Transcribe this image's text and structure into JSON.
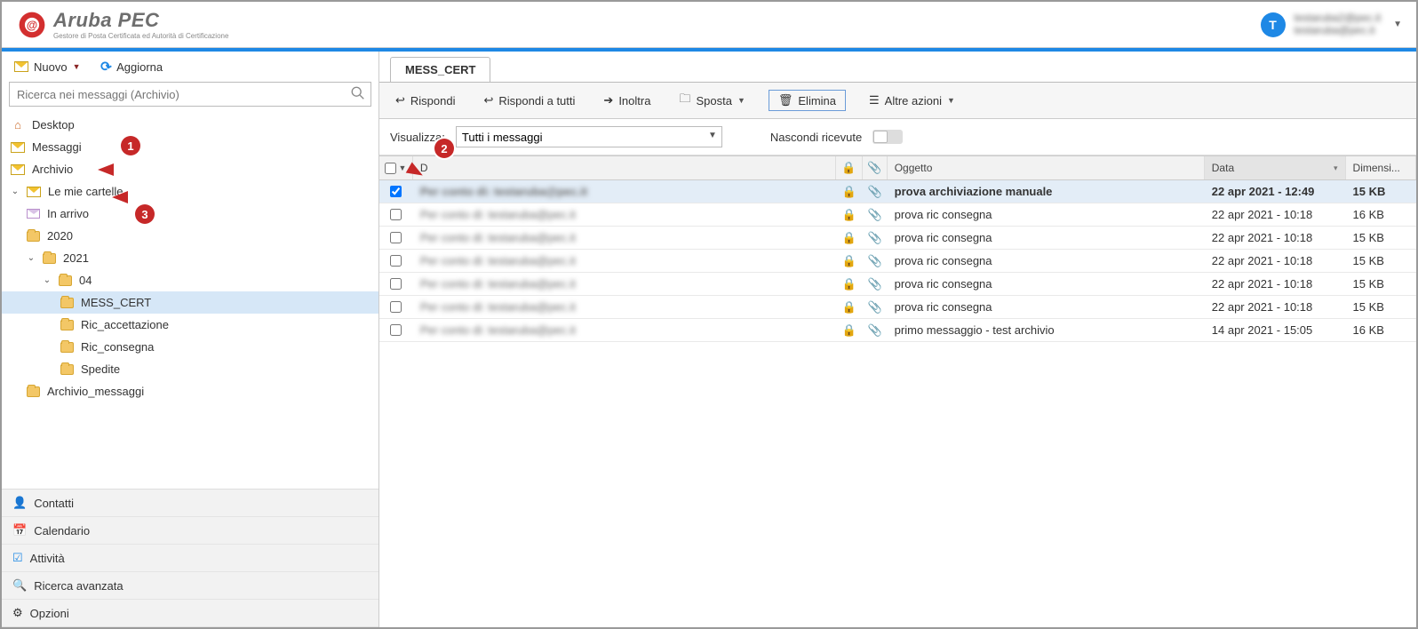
{
  "brand": {
    "name": "Aruba PEC",
    "sub": "Gestore di Posta Certificata ed Autorità di Certificazione"
  },
  "user": {
    "initial": "T",
    "line1": "testaruba2@pec.it",
    "line2": "testaruba@pec.it"
  },
  "actions": {
    "new": "Nuovo",
    "refresh": "Aggiorna"
  },
  "search": {
    "placeholder": "Ricerca nei messaggi (Archivio)"
  },
  "tree": {
    "desktop": "Desktop",
    "messaggi": "Messaggi",
    "archivio": "Archivio",
    "lemie": "Le mie cartelle",
    "inarrivo": "In arrivo",
    "y2020": "2020",
    "y2021": "2021",
    "m04": "04",
    "messcert": "MESS_CERT",
    "ricacc": "Ric_accettazione",
    "riccon": "Ric_consegna",
    "spedite": "Spedite",
    "archmsg": "Archivio_messaggi"
  },
  "bottomnav": {
    "contatti": "Contatti",
    "calendario": "Calendario",
    "attivita": "Attività",
    "ricerca": "Ricerca avanzata",
    "opzioni": "Opzioni"
  },
  "tab": "MESS_CERT",
  "toolbar": {
    "rispondi": "Rispondi",
    "rispondi_tutti": "Rispondi a tutti",
    "inoltra": "Inoltra",
    "sposta": "Sposta",
    "elimina": "Elimina",
    "altre": "Altre azioni"
  },
  "filter": {
    "label": "Visualizza:",
    "value": "Tutti i messaggi",
    "hide": "Nascondi ricevute"
  },
  "columns": {
    "da": "D",
    "oggetto": "Oggetto",
    "data": "Data",
    "dim": "Dimensi..."
  },
  "rows": [
    {
      "from": "Per conto di: testaruba@pec.it",
      "subject": "prova archiviazione manuale",
      "date": "22 apr 2021 - 12:49",
      "size": "15 KB",
      "selected": true
    },
    {
      "from": "Per conto di: testaruba@pec.it",
      "subject": "prova ric consegna",
      "date": "22 apr 2021 - 10:18",
      "size": "16 KB",
      "selected": false
    },
    {
      "from": "Per conto di: testaruba@pec.it",
      "subject": "prova ric consegna",
      "date": "22 apr 2021 - 10:18",
      "size": "15 KB",
      "selected": false
    },
    {
      "from": "Per conto di: testaruba@pec.it",
      "subject": "prova ric consegna",
      "date": "22 apr 2021 - 10:18",
      "size": "15 KB",
      "selected": false
    },
    {
      "from": "Per conto di: testaruba@pec.it",
      "subject": "prova ric consegna",
      "date": "22 apr 2021 - 10:18",
      "size": "15 KB",
      "selected": false
    },
    {
      "from": "Per conto di: testaruba@pec.it",
      "subject": "prova ric consegna",
      "date": "22 apr 2021 - 10:18",
      "size": "15 KB",
      "selected": false
    },
    {
      "from": "Per conto di: testaruba@pec.it",
      "subject": "primo messaggio - test archivio",
      "date": "14 apr 2021 - 15:05",
      "size": "16 KB",
      "selected": false
    }
  ],
  "callouts": {
    "c1": "1",
    "c2": "2",
    "c3": "3"
  }
}
